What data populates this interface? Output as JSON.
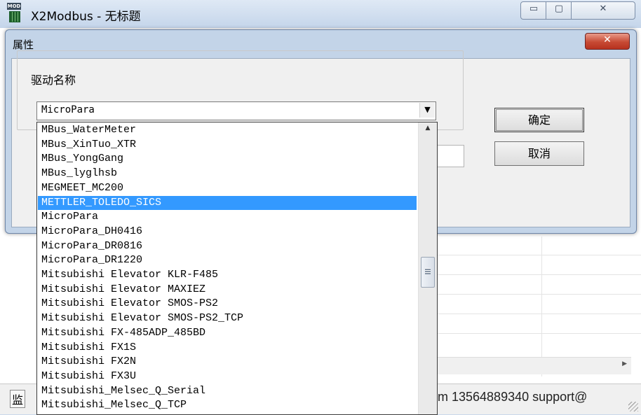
{
  "window": {
    "icon_text": "MOD",
    "title": "X2Modbus - 无标题",
    "min_glyph": "▭",
    "max_glyph": "▢",
    "close_glyph": "✕"
  },
  "dialog": {
    "title": "属性",
    "close_glyph": "✕",
    "group_label": "驱动名称",
    "selected_value": "MicroPara",
    "dropdown_glyph": "▼",
    "ok_label": "确定",
    "cancel_label": "取消"
  },
  "driver_list": {
    "items": [
      "MBus_WaterMeter",
      "MBus_XinTuo_XTR",
      "MBus_YongGang",
      "MBus_lyglhsb",
      "MEGMEET_MC200",
      "METTLER_TOLEDO_SICS",
      "MicroPara",
      "MicroPara_DH0416",
      "MicroPara_DR0816",
      "MicroPara_DR1220",
      "Mitsubishi Elevator KLR-F485",
      "Mitsubishi Elevator MAXIEZ",
      "Mitsubishi Elevator SMOS-PS2",
      "Mitsubishi Elevator SMOS-PS2_TCP",
      "Mitsubishi FX-485ADP_485BD",
      "Mitsubishi FX1S",
      "Mitsubishi FX2N",
      "Mitsubishi FX3U",
      "Mitsubishi_Melsec_Q_Serial",
      "Mitsubishi_Melsec_Q_TCP"
    ],
    "highlighted_index": 5,
    "scroll_up_glyph": "▲"
  },
  "statusbar": {
    "left_text": "监",
    "right_text": "m 13564889340 support@"
  },
  "hscroll": {
    "right_glyph": "▶"
  },
  "colors": {
    "selection": "#3399ff",
    "titlebar": "#c4d5ea",
    "dialog_close": "#c74a34"
  }
}
